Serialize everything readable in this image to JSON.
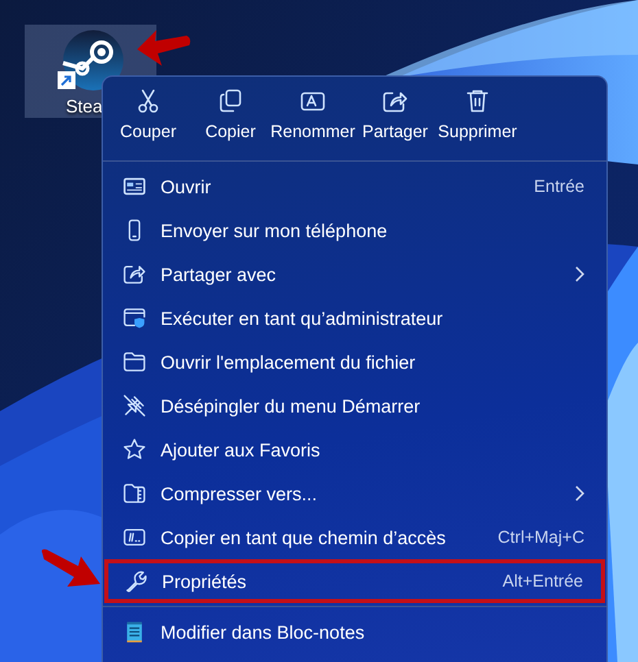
{
  "desktop_icon": {
    "label": "Stea",
    "selected": true,
    "arrow": true
  },
  "menu": {
    "toolbar": [
      {
        "label": "Couper"
      },
      {
        "label": "Copier"
      },
      {
        "label": "Renommer"
      },
      {
        "label": "Partager"
      },
      {
        "label": "Supprimer"
      }
    ],
    "groups": [
      [
        {
          "label": "Ouvrir",
          "shortcut": "Entrée",
          "submenu": false,
          "highlighted": false,
          "arrow": false
        },
        {
          "label": "Envoyer sur mon téléphone",
          "submenu": false,
          "highlighted": false,
          "arrow": false
        },
        {
          "label": "Partager avec",
          "submenu": true,
          "highlighted": false,
          "arrow": false
        },
        {
          "label": "Exécuter en tant qu’administrateur",
          "submenu": false,
          "highlighted": false,
          "arrow": false
        },
        {
          "label": "Ouvrir l'emplacement du fichier",
          "submenu": false,
          "highlighted": false,
          "arrow": false
        },
        {
          "label": "Désépingler du menu Démarrer",
          "submenu": false,
          "highlighted": false,
          "arrow": false
        },
        {
          "label": "Ajouter aux Favoris",
          "submenu": false,
          "highlighted": false,
          "arrow": false
        },
        {
          "label": "Compresser vers...",
          "submenu": true,
          "highlighted": false,
          "arrow": false
        },
        {
          "label": "Copier en tant que chemin d’accès",
          "shortcut": "Ctrl+Maj+C",
          "submenu": false,
          "highlighted": false,
          "arrow": false
        },
        {
          "label": "Propriétés",
          "shortcut": "Alt+Entrée",
          "submenu": false,
          "highlighted": true,
          "arrow": true
        }
      ],
      [
        {
          "label": "Modifier dans Bloc-notes",
          "submenu": false,
          "highlighted": false,
          "arrow": false
        }
      ]
    ]
  }
}
